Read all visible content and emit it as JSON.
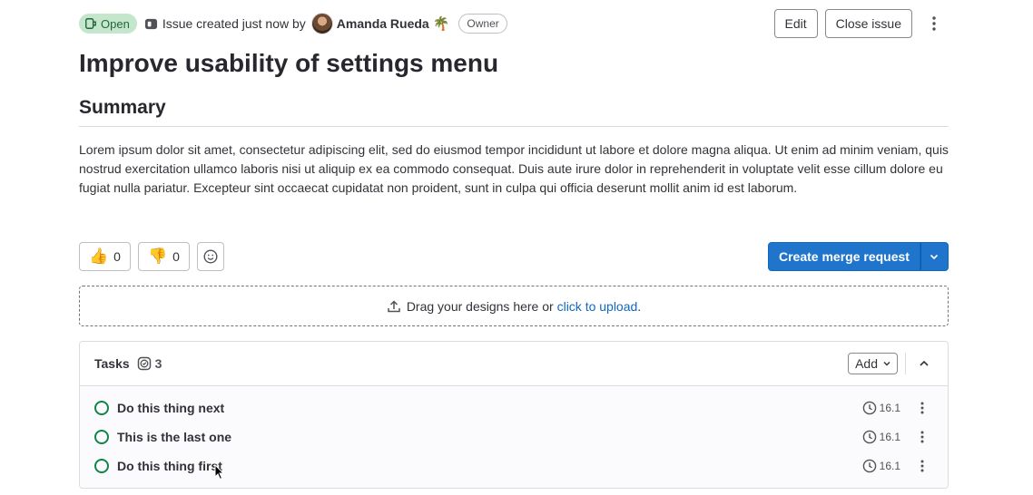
{
  "header": {
    "status": "Open",
    "created_text": "Issue created just now by",
    "author": "Amanda Rueda",
    "author_emoji": "🌴",
    "role_badge": "Owner",
    "edit_label": "Edit",
    "close_label": "Close issue"
  },
  "issue": {
    "title": "Improve usability of settings menu",
    "summary_heading": "Summary",
    "description": "Lorem ipsum dolor sit amet, consectetur adipiscing elit, sed do eiusmod tempor incididunt ut labore et dolore magna aliqua. Ut enim ad minim veniam, quis nostrud exercitation ullamco laboris nisi ut aliquip ex ea commodo consequat. Duis aute irure dolor in reprehenderit in voluptate velit esse cillum dolore eu fugiat nulla pariatur. Excepteur sint occaecat cupidatat non proident, sunt in culpa qui officia deserunt mollit anim id est laborum."
  },
  "reactions": {
    "thumbs_up_emoji": "👍",
    "thumbs_up_count": "0",
    "thumbs_down_emoji": "👎",
    "thumbs_down_count": "0"
  },
  "merge_request": {
    "label": "Create merge request"
  },
  "design_upload": {
    "text": "Drag your designs here or",
    "link": "click to upload",
    "suffix": "."
  },
  "tasks": {
    "title": "Tasks",
    "count": "3",
    "add_label": "Add",
    "items": [
      {
        "title": "Do this thing next",
        "milestone": "16.1"
      },
      {
        "title": "This is the last one",
        "milestone": "16.1"
      },
      {
        "title": "Do this thing first",
        "milestone": "16.1"
      }
    ]
  },
  "colors": {
    "status_open_bg": "#c3e6cd",
    "status_open_text": "#24663b",
    "primary": "#1f75cb",
    "link": "#1068bf",
    "task_open": "#108548"
  }
}
